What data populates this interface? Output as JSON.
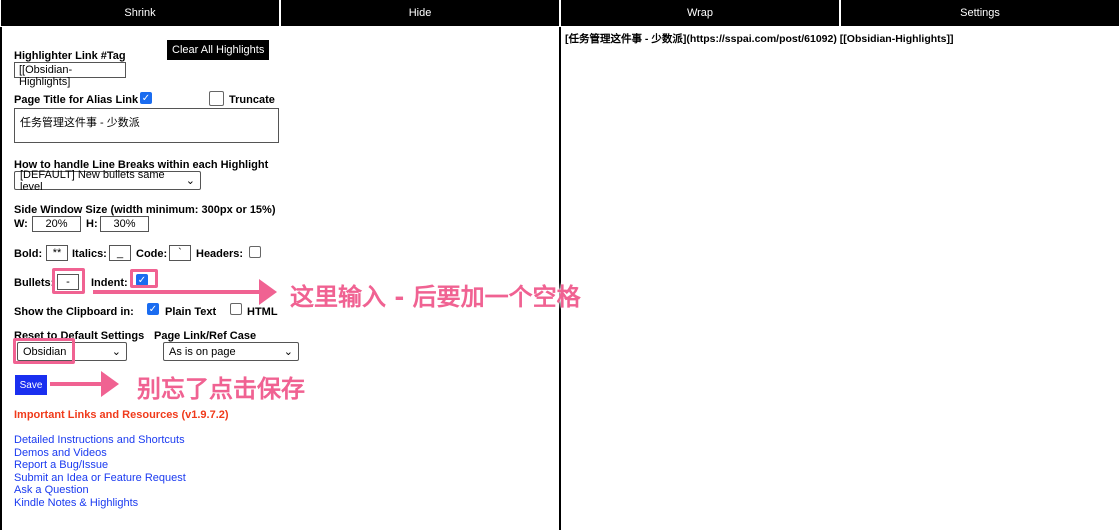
{
  "topbar": {
    "shrink": "Shrink",
    "hide": "Hide",
    "wrap": "Wrap",
    "settings": "Settings"
  },
  "settings": {
    "clear_all": "Clear All Highlights",
    "tag_label": "Highlighter Link #Tag",
    "tag_value": "[[Obsidian-Highlights]",
    "alias_label": "Page Title for Alias Link",
    "alias_checked": true,
    "truncate_label": "Truncate",
    "truncate_checked": false,
    "title_value": "任务管理这件事 - 少数派",
    "linebreak_label": "How to handle Line Breaks within each Highlight",
    "linebreak_value": "[DEFAULT] New bullets same level",
    "side_label": "Side Window Size (width minimum: 300px or 15%)",
    "w_label": "W:",
    "w_value": "20%",
    "h_label": "H:",
    "h_value": "30%",
    "bold_label": "Bold:",
    "bold_value": "**",
    "italics_label": "Italics:",
    "italics_value": "_",
    "code_label": "Code:",
    "code_value": "`",
    "headers_label": "Headers:",
    "headers_checked": false,
    "bullets_label": "Bullets:",
    "bullets_value": "-",
    "indent_label": "Indent:",
    "indent_checked": true,
    "clipboard_label": "Show the Clipboard in:",
    "plain_label": "Plain Text",
    "plain_checked": true,
    "html_label": "HTML",
    "html_checked": false,
    "reset_label": "Reset to Default Settings",
    "reset_value": "Obsidian",
    "case_label": "Page Link/Ref Case",
    "case_value": "As is on page",
    "save": "Save"
  },
  "resources": {
    "title": "Important Links and Resources (v1.9.7.2)",
    "links": [
      "Detailed Instructions and Shortcuts",
      "Demos and Videos",
      "Report a Bug/Issue",
      "Submit an Idea or Feature Request",
      "Ask a Question",
      "Kindle Notes & Highlights"
    ]
  },
  "annotations": {
    "bullets_note": "这里输入 - 后要加一个空格",
    "save_note": "别忘了点击保存",
    "color": "#f06292"
  },
  "clipboard_output": "[任务管理这件事 - 少数派](https://sspai.com/post/61092) [[Obsidian-Highlights]]"
}
